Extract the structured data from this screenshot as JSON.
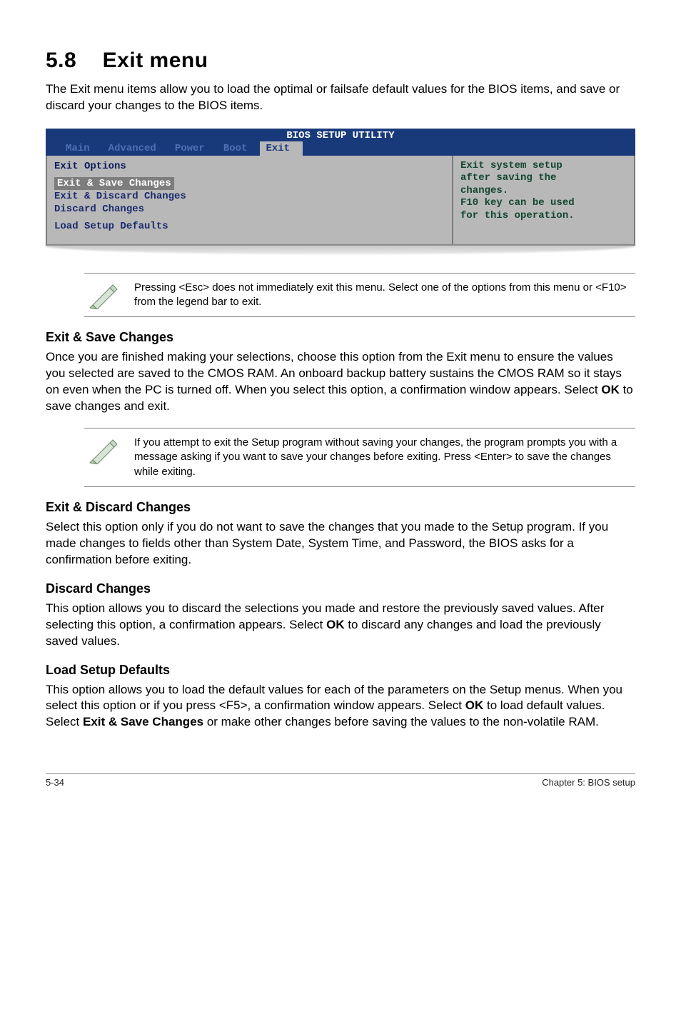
{
  "section": {
    "number": "5.8",
    "title": "Exit menu"
  },
  "intro": "The Exit menu items allow you to load the optimal or failsafe default values for the BIOS items, and save or discard your changes to the BIOS items.",
  "bios": {
    "header": "BIOS SETUP UTILITY",
    "tabs": [
      "Main",
      "Advanced",
      "Power",
      "Boot",
      "Exit"
    ],
    "active_tab": "Exit",
    "left_items": [
      "Exit Options",
      "Exit & Save Changes",
      "Exit & Discard Changes",
      "Discard Changes",
      "Load Setup Defaults"
    ],
    "selected_item": "Exit & Save Changes",
    "right_lines": [
      "Exit system setup",
      "after saving the",
      "changes.",
      "",
      "F10 key can be used",
      "for this operation."
    ]
  },
  "note1": "Pressing <Esc> does not immediately exit this menu. Select one of the options from this menu or <F10> from the legend bar to exit.",
  "sections": {
    "save": {
      "heading": "Exit & Save Changes",
      "body_parts": [
        "Once you are finished making your selections, choose this option from the Exit menu to ensure the values you selected are saved to the CMOS RAM. An onboard backup battery sustains the CMOS RAM so it stays on even when the PC is turned off. When you select this option, a confirmation window appears. Select ",
        "OK",
        " to save changes and exit."
      ]
    },
    "note2": " If you attempt to exit the Setup program without saving your changes, the program prompts you with a message asking if you want to save your changes before exiting. Press <Enter>  to save the  changes while exiting.",
    "discard_exit": {
      "heading": "Exit & Discard Changes",
      "body": "Select this option only if you do not want to save the changes that you  made to the Setup program. If you made changes to fields other than System Date, System Time, and Password, the BIOS asks for a confirmation before exiting."
    },
    "discard": {
      "heading": "Discard Changes",
      "body_parts": [
        "This option allows you to discard the selections you made and restore the previously saved values. After selecting this option, a confirmation appears. Select ",
        "OK",
        " to discard any changes and load the previously saved values."
      ]
    },
    "load": {
      "heading": "Load Setup Defaults",
      "body_parts": [
        "This option allows you to load the default values for each of the parameters on the Setup menus. When you select this option or if you press <F5>, a confirmation window appears. Select ",
        "OK",
        " to load default values. Select ",
        "Exit & Save Changes",
        " or make other changes before saving the values to the non-volatile RAM."
      ]
    }
  },
  "footer": {
    "left": "5-34",
    "right": "Chapter 5: BIOS setup"
  }
}
